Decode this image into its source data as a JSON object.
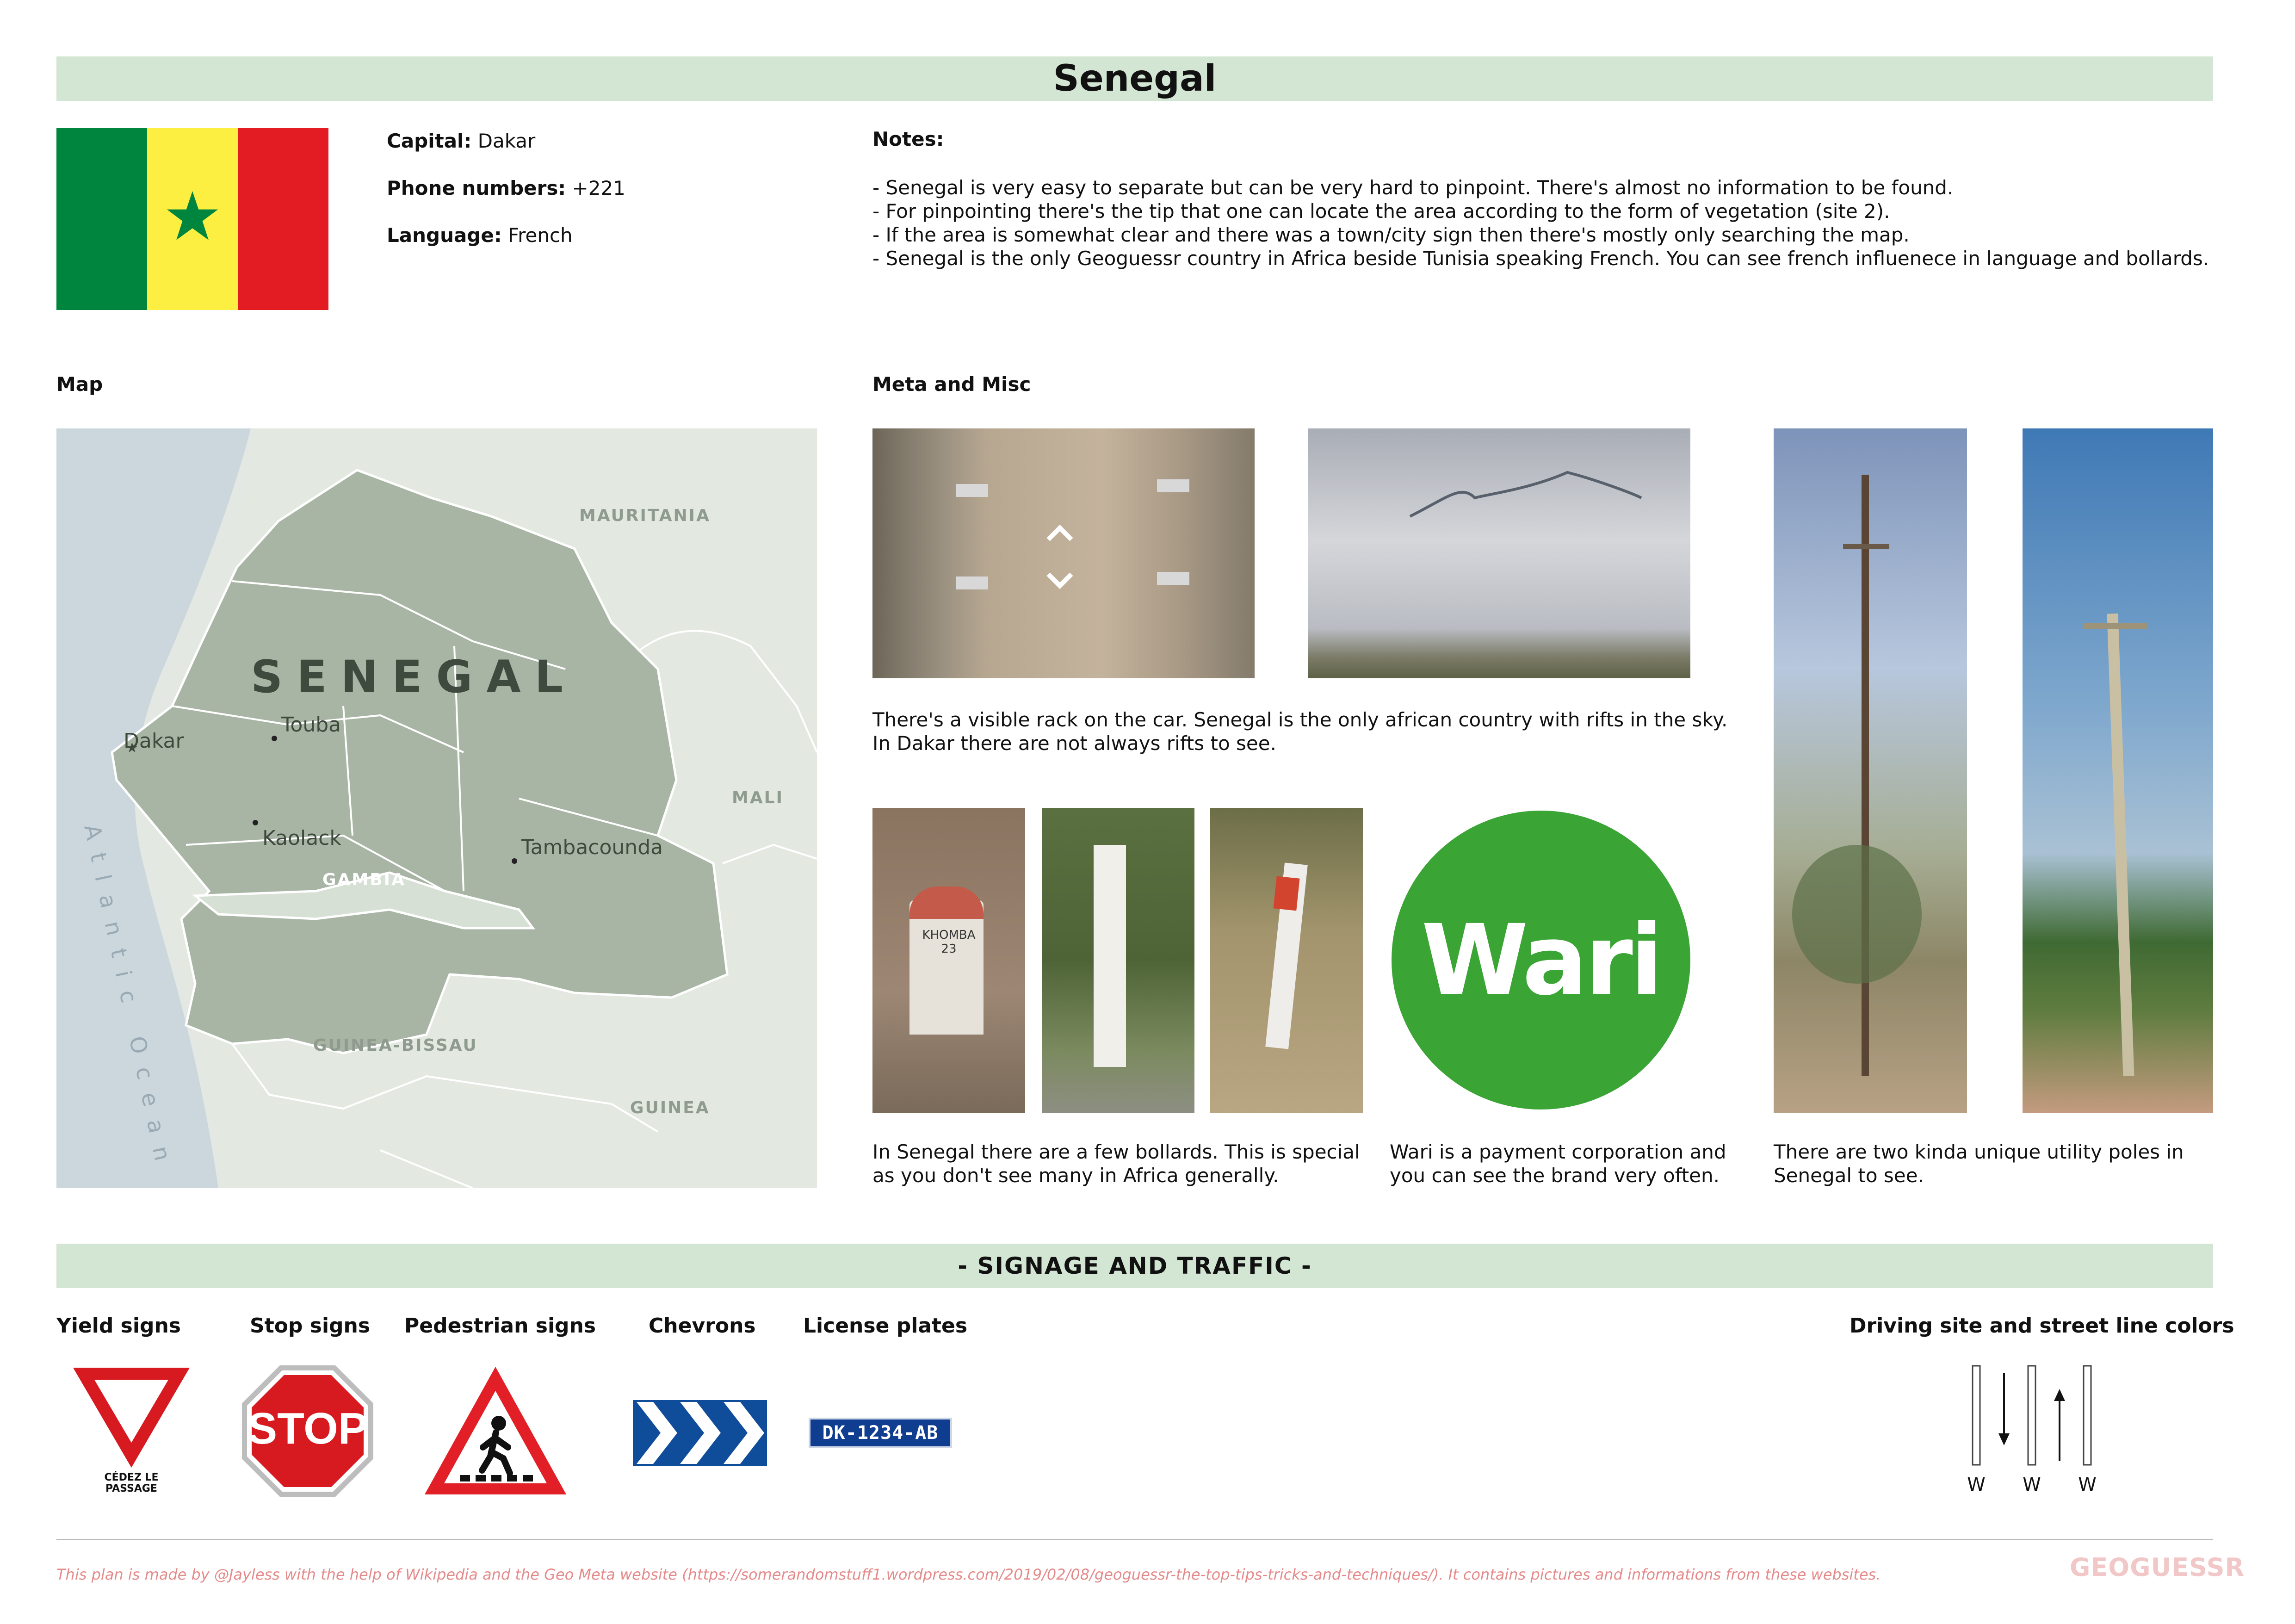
{
  "header": {
    "title": "Senegal"
  },
  "info": {
    "capital_label": "Capital:",
    "capital_value": "Dakar",
    "phone_label": "Phone numbers:",
    "phone_value": "+221",
    "language_label": "Language:",
    "language_value": "French"
  },
  "flag": {
    "colors": [
      "#00853f",
      "#fdef42",
      "#e31b23"
    ],
    "star_color": "#00853f"
  },
  "notes": {
    "heading": "Notes:",
    "items": [
      "- Senegal is very easy to separate but can be very hard to pinpoint. There's almost no information to be found.",
      "- For pinpointing there's the tip that one can locate the area according to the form of vegetation (site 2).",
      "- If the area is somewhat clear and there was a town/city sign then there's mostly only searching the map.",
      "- Senegal is the only Geoguessr country in Africa beside Tunisia speaking French. You can see french influenece in language and bollards."
    ]
  },
  "map": {
    "heading": "Map",
    "country_label": "SENEGAL",
    "cities": [
      "Dakar",
      "Touba",
      "Kaolack",
      "Tambacounda"
    ],
    "neighbors": [
      "MAURITANIA",
      "MALI",
      "GAMBIA",
      "GUINEA-BISSAU",
      "GUINEA"
    ],
    "ocean": "Atlantic Ocean"
  },
  "meta": {
    "heading": "Meta and Misc",
    "car_caption_1": "There's a visible rack on the car. Senegal is the only african country with rifts in the sky.",
    "car_caption_2": "In Dakar there are not always rifts to see.",
    "bollard_caption_1": "In Senegal there are a few bollards. This is special",
    "bollard_caption_2": "as you don't see many in Africa generally.",
    "bollard_text": "KHOMBA\n23",
    "wari_logo": "Wari",
    "wari_color": "#3aa535",
    "wari_caption_1": "Wari is a payment corporation and",
    "wari_caption_2": "you can see the brand very often.",
    "poles_caption_1": "There are two kinda unique utility poles in",
    "poles_caption_2": "Senegal to see."
  },
  "signage": {
    "band": "- SIGNAGE AND TRAFFIC -",
    "yield_label": "Yield signs",
    "yield_text_1": "CÉDEZ LE",
    "yield_text_2": "PASSAGE",
    "stop_label": "Stop signs",
    "stop_text": "STOP",
    "pedestrian_label": "Pedestrian signs",
    "chevrons_label": "Chevrons",
    "plates_label": "License plates",
    "plate_text": "DK-1234-AB",
    "driving_label": "Driving site and street line colors",
    "line_labels": [
      "W",
      "W",
      "W"
    ]
  },
  "footer": {
    "text": "This plan is made by @Jayless with the help of Wikipedia and the Geo Meta website (https://somerandomstuff1.wordpress.com/2019/02/08/geoguessr-the-top-tips-tricks-and-techniques/). It contains pictures and informations from these websites.",
    "logo": "GEOGUESSR"
  }
}
